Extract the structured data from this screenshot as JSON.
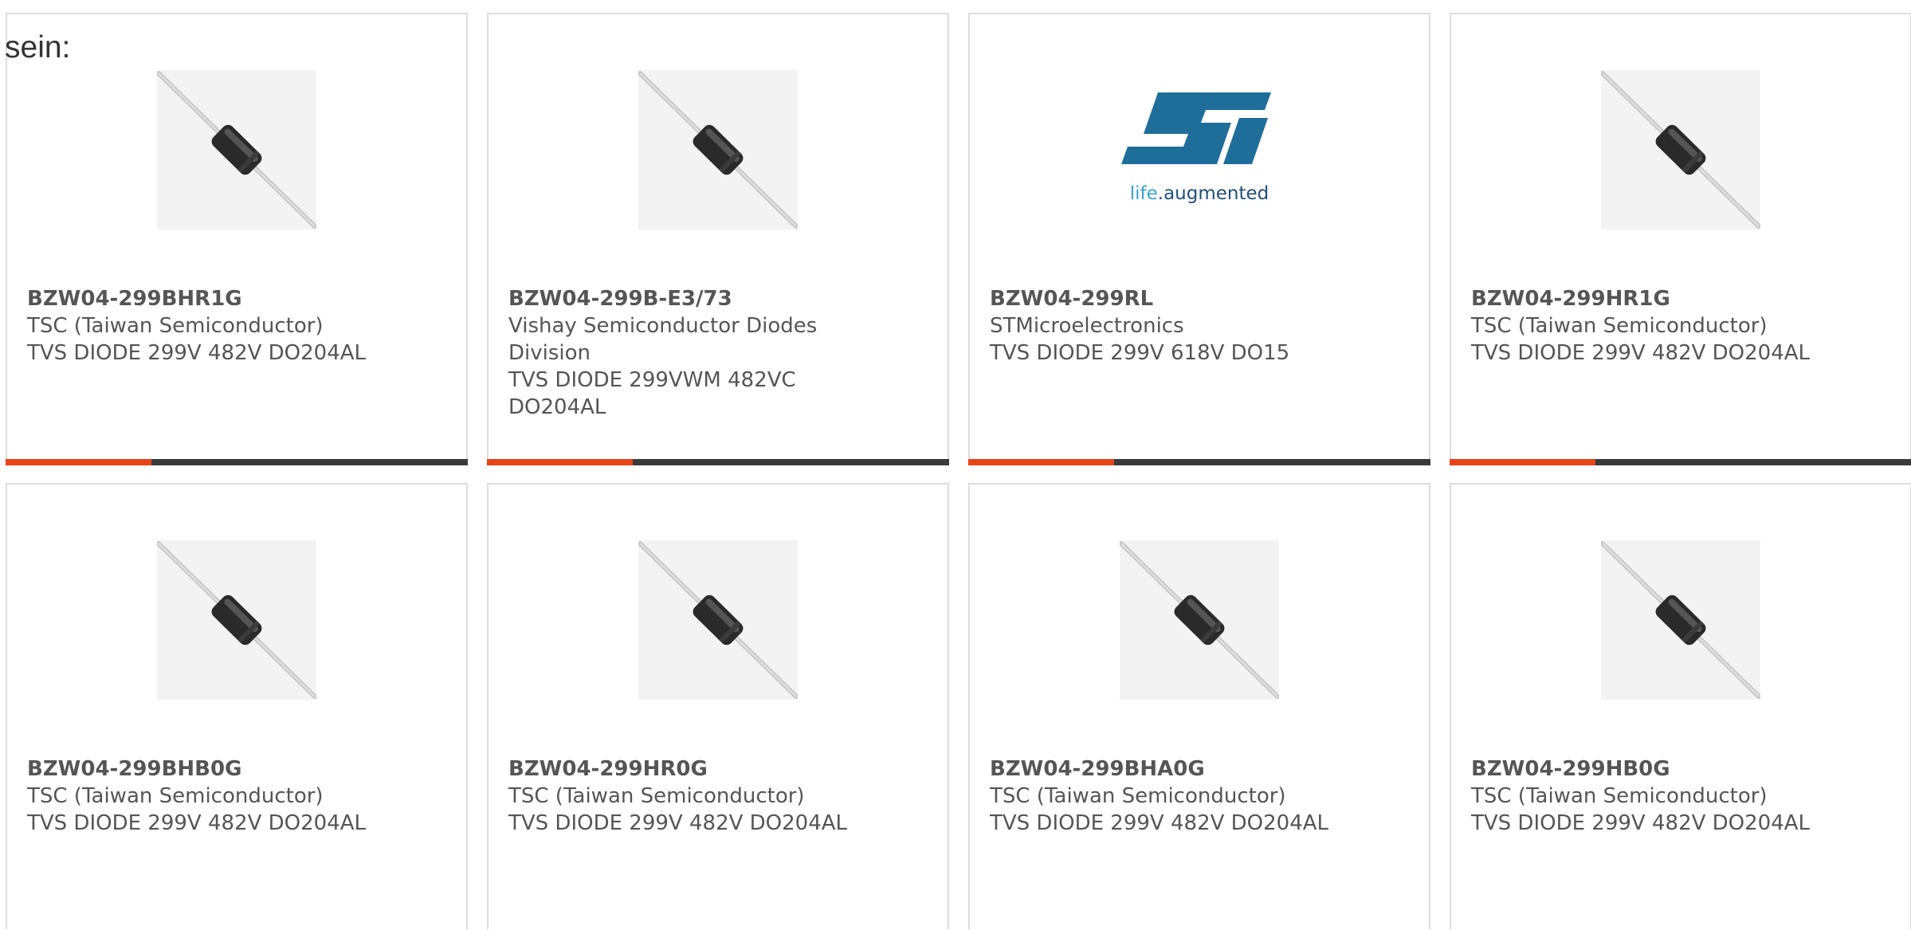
{
  "intro_text": "sein:",
  "products": [
    {
      "part_number": "BZW04-299BHR1G",
      "manufacturer": "TSC (Taiwan Semiconductor)",
      "description": "TVS DIODE 299V 482V DO204AL",
      "image": "diode-icon"
    },
    {
      "part_number": "BZW04-299B-E3/73",
      "manufacturer": "Vishay Semiconductor Diodes Division",
      "description": "TVS DIODE 299VWM 482VC DO204AL",
      "image": "diode-icon"
    },
    {
      "part_number": "BZW04-299RL",
      "manufacturer": "STMicroelectronics",
      "description": "TVS DIODE 299V 618V DO15",
      "image": "st-logo",
      "logo_tagline": "life.augmented",
      "logo_colors": {
        "mark": "#1f6e9a",
        "tagline_accent": "#3aa3d4",
        "tagline": "#1f4f7a"
      }
    },
    {
      "part_number": "BZW04-299HR1G",
      "manufacturer": "TSC (Taiwan Semiconductor)",
      "description": "TVS DIODE 299V 482V DO204AL",
      "image": "diode-icon"
    },
    {
      "part_number": "BZW04-299BHB0G",
      "manufacturer": "TSC (Taiwan Semiconductor)",
      "description": "TVS DIODE 299V 482V DO204AL",
      "image": "diode-icon"
    },
    {
      "part_number": "BZW04-299HR0G",
      "manufacturer": "TSC (Taiwan Semiconductor)",
      "description": "TVS DIODE 299V 482V DO204AL",
      "image": "diode-icon"
    },
    {
      "part_number": "BZW04-299BHA0G",
      "manufacturer": "TSC (Taiwan Semiconductor)",
      "description": "TVS DIODE 299V 482V DO204AL",
      "image": "diode-icon"
    },
    {
      "part_number": "BZW04-299HB0G",
      "manufacturer": "TSC (Taiwan Semiconductor)",
      "description": "TVS DIODE 299V 482V DO204AL",
      "image": "diode-icon"
    }
  ],
  "colors": {
    "accent": "#e8441a",
    "bar": "#3a3a3a",
    "border": "#dddddd",
    "text": "#555555"
  }
}
